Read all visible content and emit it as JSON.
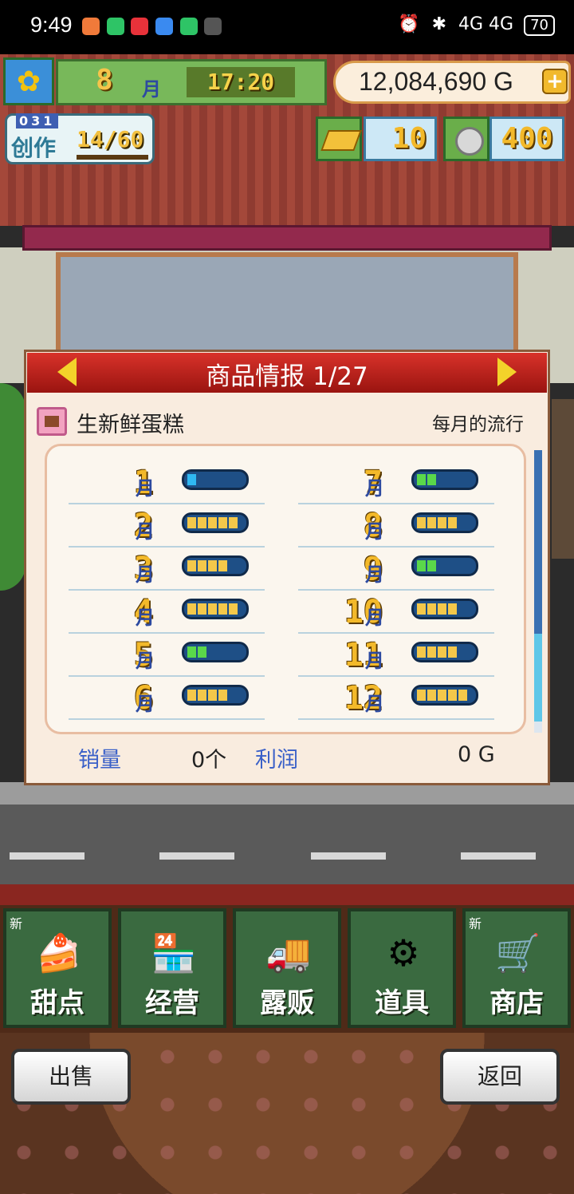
{
  "status_bar": {
    "time": "9:49",
    "right_text": "4G 4G",
    "battery": "70"
  },
  "hud": {
    "month_num": "8",
    "month_unit": "月",
    "clock": "17:20",
    "money": "12,084,690 G",
    "create_digits": "031",
    "create_label": "创作",
    "create_count": "14/60",
    "gold_bars": "10",
    "silver_coins": "400"
  },
  "dialog": {
    "title": "商品情报 1/27",
    "product": "生新鲜蛋糕",
    "trend_label": "每月的流行",
    "months": [
      {
        "num": "1",
        "unit": "月",
        "level": 1,
        "color": "#2fb8f2"
      },
      {
        "num": "2",
        "unit": "月",
        "level": 5,
        "color": "#f4c84a"
      },
      {
        "num": "3",
        "unit": "月",
        "level": 4,
        "color": "#f4c84a"
      },
      {
        "num": "4",
        "unit": "月",
        "level": 5,
        "color": "#f4c84a"
      },
      {
        "num": "5",
        "unit": "月",
        "level": 2,
        "color": "#5ad84a"
      },
      {
        "num": "6",
        "unit": "月",
        "level": 4,
        "color": "#f4c84a"
      },
      {
        "num": "7",
        "unit": "月",
        "level": 2,
        "color": "#5ad84a"
      },
      {
        "num": "8",
        "unit": "月",
        "level": 4,
        "color": "#f4c84a"
      },
      {
        "num": "9",
        "unit": "月",
        "level": 2,
        "color": "#5ad84a"
      },
      {
        "num": "10",
        "unit": "月",
        "level": 4,
        "color": "#f4c84a"
      },
      {
        "num": "11",
        "unit": "月",
        "level": 4,
        "color": "#f4c84a"
      },
      {
        "num": "12",
        "unit": "月",
        "level": 5,
        "color": "#f4c84a"
      }
    ],
    "sales_label": "销量",
    "sales_value": "0个",
    "profit_label": "利润",
    "profit_value": "0 G"
  },
  "nav": [
    {
      "label": "甜点",
      "new": "新",
      "icon": "cake-icon"
    },
    {
      "label": "经营",
      "new": "",
      "icon": "shop-icon"
    },
    {
      "label": "露贩",
      "new": "",
      "icon": "food-truck-icon"
    },
    {
      "label": "道具",
      "new": "",
      "icon": "items-icon"
    },
    {
      "label": "商店",
      "new": "新",
      "icon": "cart-icon"
    }
  ],
  "buttons": {
    "sell": "出售",
    "back": "返回"
  }
}
